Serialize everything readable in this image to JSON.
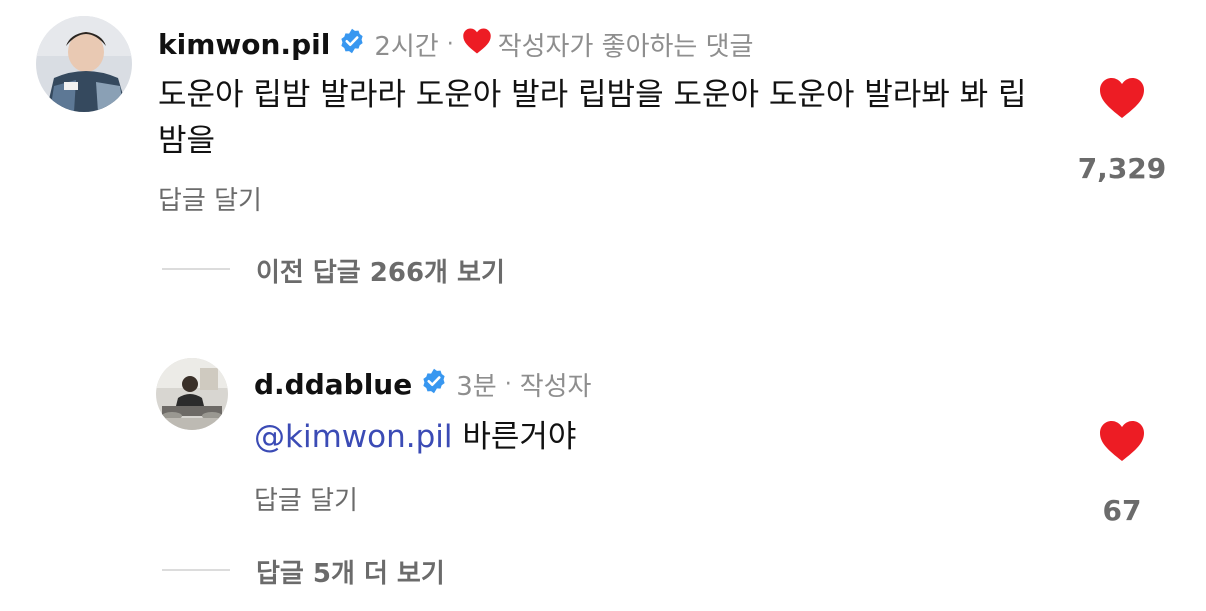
{
  "comment": {
    "username": "kimwon.pil",
    "time": "2시간",
    "separator": "·",
    "creator_liked_label": "작성자가 좋아하는 댓글",
    "text": "도운아 립밤 발라라 도운아 발라 립밤을 도운아 도운아 발라봐 봐 립밤을",
    "reply_label": "답글 달기",
    "like_count": "7,329",
    "heart_color": "#ed1c24"
  },
  "view_previous_replies": "이전 답글 266개 보기",
  "reply": {
    "username": "d.ddablue",
    "time": "3분",
    "separator": "·",
    "author_badge": "작성자",
    "mention": "@kimwon.pil",
    "text": "바른거야",
    "reply_label": "답글 달기",
    "like_count": "67",
    "heart_color": "#ed1c24"
  },
  "view_more_replies": "답글 5개 더 보기",
  "verified_color": "#3897f0"
}
